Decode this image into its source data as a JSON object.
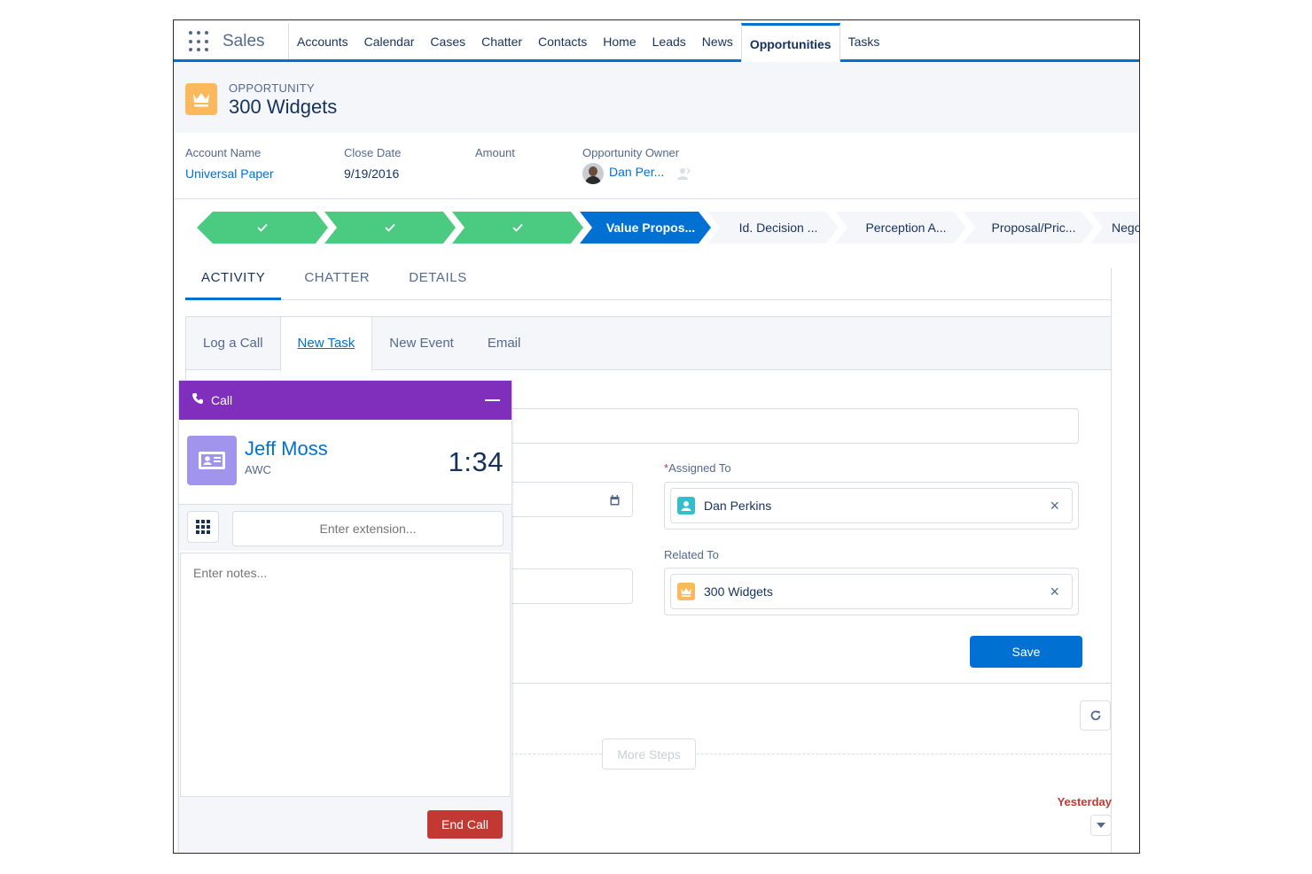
{
  "app": {
    "name": "Sales"
  },
  "nav": {
    "items": [
      {
        "label": "Accounts"
      },
      {
        "label": "Calendar"
      },
      {
        "label": "Cases"
      },
      {
        "label": "Chatter"
      },
      {
        "label": "Contacts"
      },
      {
        "label": "Home"
      },
      {
        "label": "Leads"
      },
      {
        "label": "News"
      },
      {
        "label": "Opportunities",
        "active": true
      },
      {
        "label": "Tasks"
      }
    ]
  },
  "record": {
    "type": "OPPORTUNITY",
    "title": "300 Widgets",
    "icon": "crown-icon",
    "icon_color": "#fcb95b"
  },
  "highlights": {
    "account_name": {
      "label": "Account Name",
      "value": "Universal Paper"
    },
    "close_date": {
      "label": "Close Date",
      "value": "9/19/2016"
    },
    "amount": {
      "label": "Amount",
      "value": ""
    },
    "owner": {
      "label": "Opportunity Owner",
      "value": "Dan Per..."
    }
  },
  "path": {
    "steps": [
      {
        "label": "",
        "status": "done"
      },
      {
        "label": "",
        "status": "done"
      },
      {
        "label": "",
        "status": "done"
      },
      {
        "label": "Value Propos...",
        "status": "current"
      },
      {
        "label": "Id. Decision ...",
        "status": "todo"
      },
      {
        "label": "Perception A...",
        "status": "todo"
      },
      {
        "label": "Proposal/Pric...",
        "status": "todo"
      },
      {
        "label": "Nego",
        "status": "todo"
      }
    ]
  },
  "tabs": {
    "activity": "ACTIVITY",
    "chatter": "CHATTER",
    "details": "DETAILS"
  },
  "publisher": {
    "tabs": {
      "log_call": "Log a Call",
      "new_task": "New Task",
      "new_event": "New Event",
      "email": "Email"
    },
    "assigned_to": {
      "label": "Assigned To",
      "required_mark": "*",
      "value": "Dan Perkins"
    },
    "related_to": {
      "label": "Related To",
      "value": "300 Widgets"
    },
    "save_label": "Save"
  },
  "timeline": {
    "more_steps": "More Steps",
    "yesterday": "Yesterday"
  },
  "softphone": {
    "title": "Call",
    "contact_name": "Jeff Moss",
    "company": "AWC",
    "timer": "1:34",
    "extension_placeholder": "Enter extension...",
    "notes_placeholder": "Enter notes...",
    "end_call_label": "End Call",
    "header_color": "#7f2fbc"
  }
}
